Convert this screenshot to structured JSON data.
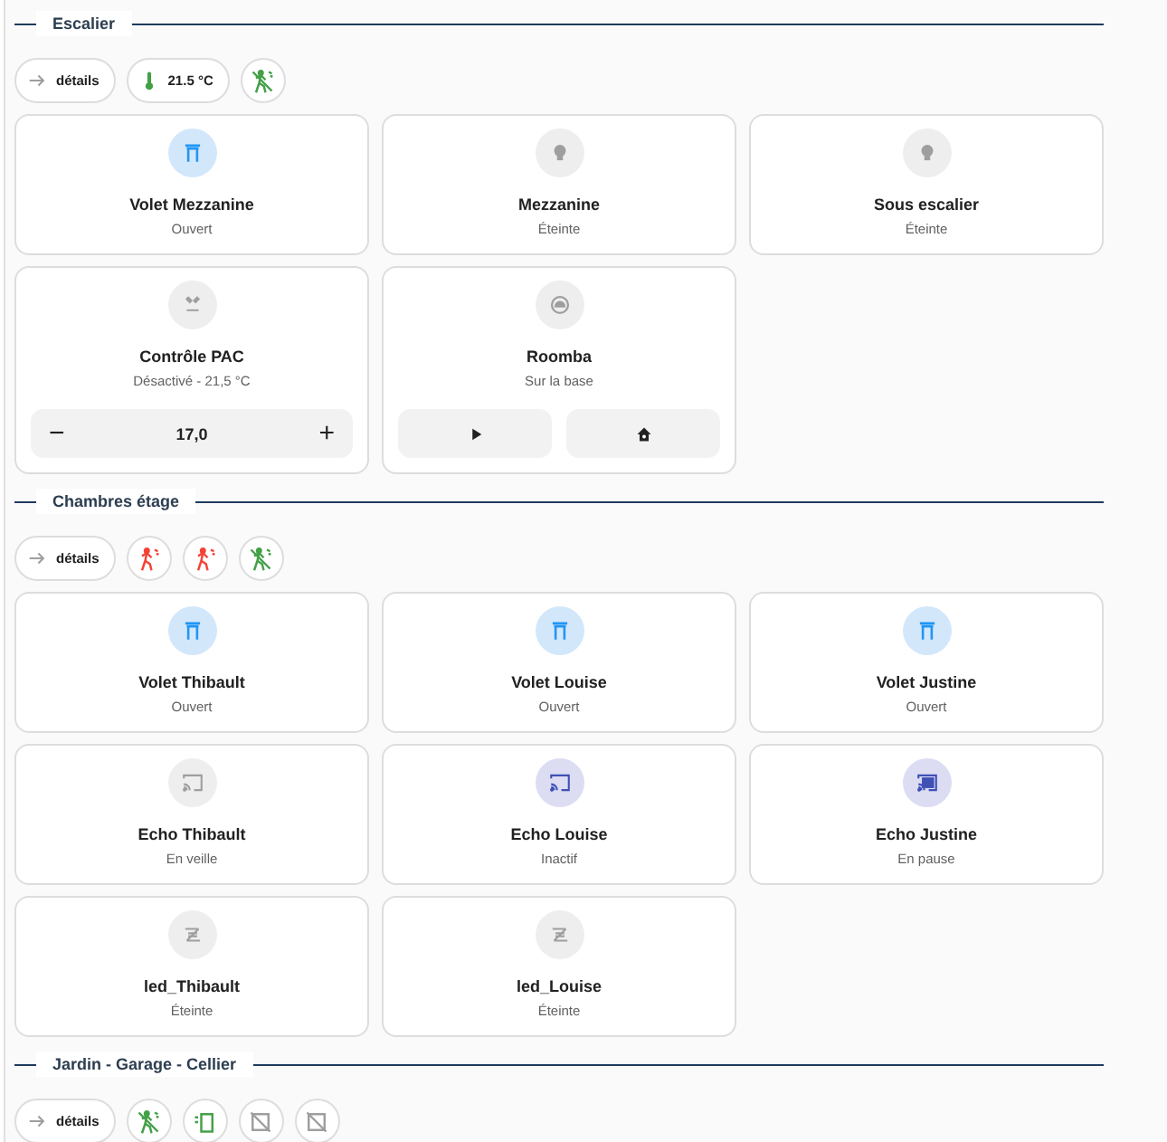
{
  "sections": [
    {
      "title": "Escalier",
      "chips": [
        {
          "kind": "details",
          "label": "détails"
        },
        {
          "kind": "temperature",
          "label": "21.5 °C"
        },
        {
          "kind": "motion",
          "detected": false
        }
      ],
      "cards": [
        {
          "name": "Volet Mezzanine",
          "state": "Ouvert",
          "kind": "shutter",
          "active": true
        },
        {
          "name": "Mezzanine",
          "state": "Éteinte",
          "kind": "bulb",
          "active": false
        },
        {
          "name": "Sous escalier",
          "state": "Éteinte",
          "kind": "bulb",
          "active": false
        },
        {
          "name": "Contrôle PAC",
          "state": "Désactivé - 21,5 °C",
          "kind": "ac",
          "active": false,
          "controls": {
            "kind": "stepper",
            "minus": "−",
            "value": "17,0",
            "plus": "+"
          }
        },
        {
          "name": "Roomba",
          "state": "Sur la base",
          "kind": "vacuum",
          "active": false,
          "controls": {
            "kind": "actions",
            "buttons": [
              {
                "kind": "play"
              },
              {
                "kind": "home"
              }
            ]
          }
        }
      ]
    },
    {
      "title": "Chambres étage",
      "chips": [
        {
          "kind": "details",
          "label": "détails"
        },
        {
          "kind": "motion",
          "detected": true
        },
        {
          "kind": "motion",
          "detected": true
        },
        {
          "kind": "motion",
          "detected": false
        }
      ],
      "cards": [
        {
          "name": "Volet Thibault",
          "state": "Ouvert",
          "kind": "shutter",
          "active": true
        },
        {
          "name": "Volet Louise",
          "state": "Ouvert",
          "kind": "shutter",
          "active": true
        },
        {
          "name": "Volet Justine",
          "state": "Ouvert",
          "kind": "shutter",
          "active": true
        },
        {
          "name": "Echo Thibault",
          "state": "En veille",
          "kind": "cast",
          "active": false
        },
        {
          "name": "Echo Louise",
          "state": "Inactif",
          "kind": "cast",
          "active": true
        },
        {
          "name": "Echo Justine",
          "state": "En pause",
          "kind": "cast-connected",
          "active": true
        },
        {
          "name": "led_Thibault",
          "state": "Éteinte",
          "kind": "led",
          "active": false
        },
        {
          "name": "led_Louise",
          "state": "Éteinte",
          "kind": "led",
          "active": false
        }
      ]
    },
    {
      "title": "Jardin - Garage - Cellier",
      "chips": [
        {
          "kind": "details",
          "label": "détails"
        },
        {
          "kind": "motion",
          "detected": false
        },
        {
          "kind": "door",
          "open": true
        },
        {
          "kind": "window",
          "open": false
        },
        {
          "kind": "window",
          "open": false
        }
      ]
    }
  ]
}
